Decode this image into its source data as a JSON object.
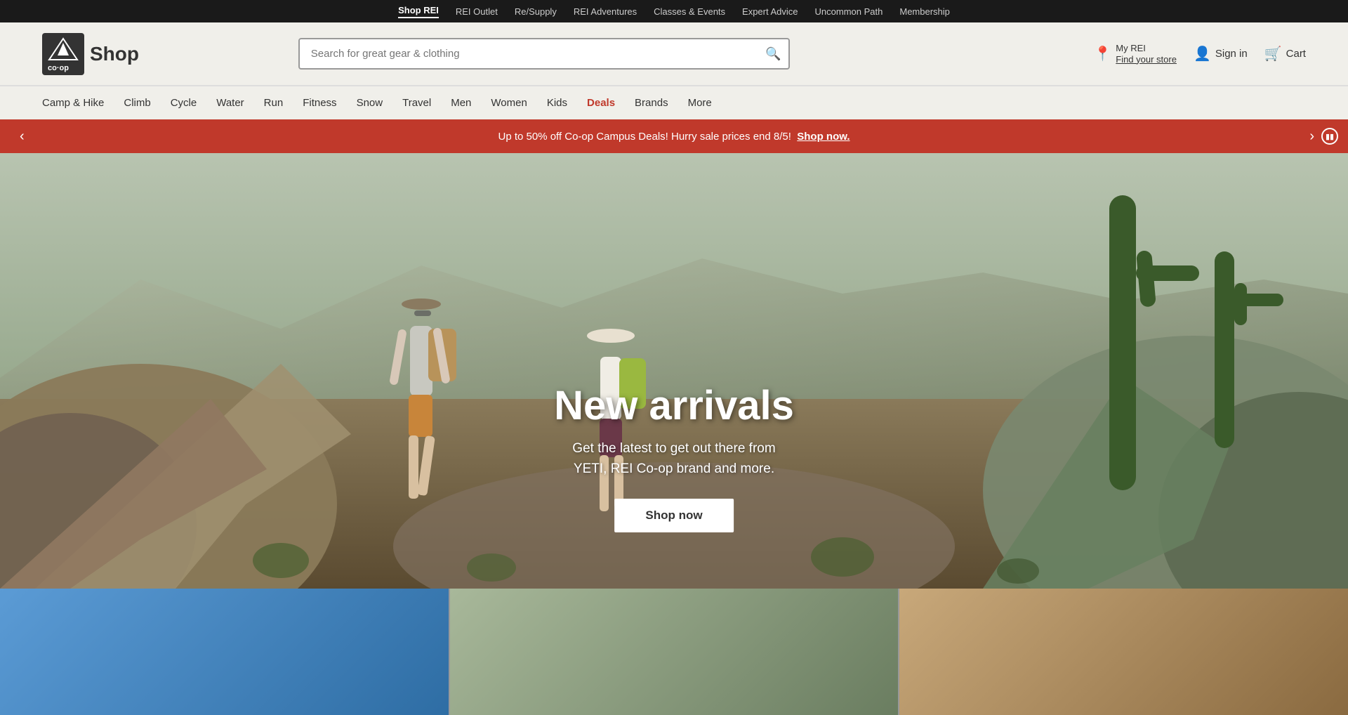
{
  "topNav": {
    "items": [
      {
        "id": "shop-rei",
        "label": "Shop REI",
        "active": true
      },
      {
        "id": "rei-outlet",
        "label": "REI Outlet",
        "active": false
      },
      {
        "id": "resupply",
        "label": "Re/Supply",
        "active": false
      },
      {
        "id": "rei-adventures",
        "label": "REI Adventures",
        "active": false
      },
      {
        "id": "classes-events",
        "label": "Classes & Events",
        "active": false
      },
      {
        "id": "expert-advice",
        "label": "Expert Advice",
        "active": false
      },
      {
        "id": "uncommon-path",
        "label": "Uncommon Path",
        "active": false
      },
      {
        "id": "membership",
        "label": "Membership",
        "active": false
      }
    ]
  },
  "header": {
    "logo_alt": "REI Co-op",
    "shop_label": "Shop",
    "search_placeholder": "Search for great gear & clothing",
    "myrei_label": "My REI",
    "find_store_label": "Find your store",
    "sign_in_label": "Sign in",
    "cart_label": "Cart"
  },
  "mainNav": {
    "items": [
      {
        "id": "camp-hike",
        "label": "Camp & Hike",
        "deals": false
      },
      {
        "id": "climb",
        "label": "Climb",
        "deals": false
      },
      {
        "id": "cycle",
        "label": "Cycle",
        "deals": false
      },
      {
        "id": "water",
        "label": "Water",
        "deals": false
      },
      {
        "id": "run",
        "label": "Run",
        "deals": false
      },
      {
        "id": "fitness",
        "label": "Fitness",
        "deals": false
      },
      {
        "id": "snow",
        "label": "Snow",
        "deals": false
      },
      {
        "id": "travel",
        "label": "Travel",
        "deals": false
      },
      {
        "id": "men",
        "label": "Men",
        "deals": false
      },
      {
        "id": "women",
        "label": "Women",
        "deals": false
      },
      {
        "id": "kids",
        "label": "Kids",
        "deals": false
      },
      {
        "id": "deals",
        "label": "Deals",
        "deals": true
      },
      {
        "id": "brands",
        "label": "Brands",
        "deals": false
      },
      {
        "id": "more",
        "label": "More",
        "deals": false
      }
    ]
  },
  "promoBanner": {
    "text": "Up to 50% off Co-op Campus Deals! Hurry sale prices end 8/5!",
    "link_text": "Shop now.",
    "link_url": "#"
  },
  "hero": {
    "title": "New arrivals",
    "subtitle": "Get the latest to get out there from\nYETI, REI Co-op brand and more.",
    "cta_label": "Shop now"
  },
  "icons": {
    "search": "🔍",
    "location_pin": "📍",
    "user": "👤",
    "cart": "🛒",
    "chevron_left": "‹",
    "chevron_right": "›",
    "pause": "⏸"
  }
}
